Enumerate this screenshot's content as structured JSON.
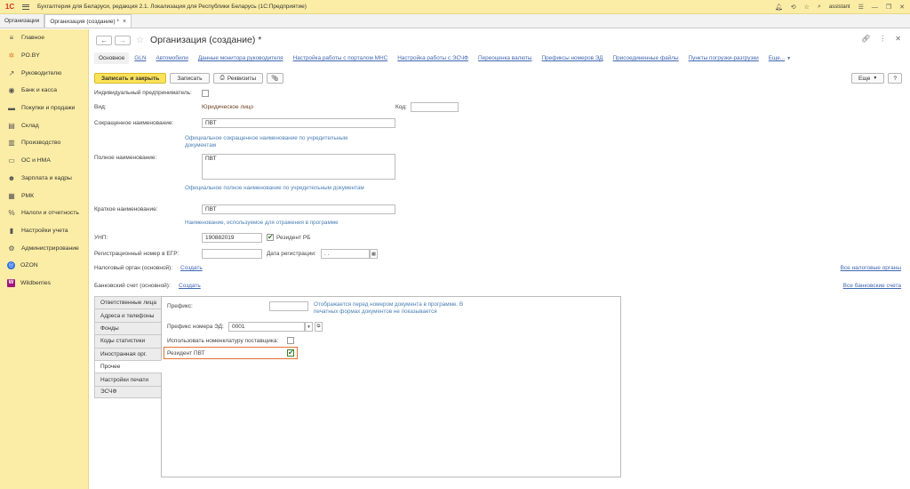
{
  "app": {
    "logo": "1С",
    "title": "Бухгалтерия для Беларуси, редакция 2.1. Локализация для Республики Беларусь  (1С:Предприятие)",
    "user": "assistant"
  },
  "tabs": [
    {
      "label": "Организации"
    },
    {
      "label": "Организация (создание) *",
      "close": "×"
    }
  ],
  "sidebar": {
    "items": [
      {
        "label": "Главное",
        "icon": "≡"
      },
      {
        "label": "PO.BY",
        "icon": "✲"
      },
      {
        "label": "Руководителю",
        "icon": "↗"
      },
      {
        "label": "Банк и касса",
        "icon": "◉"
      },
      {
        "label": "Покупки и продажи",
        "icon": "▬"
      },
      {
        "label": "Склад",
        "icon": "▤"
      },
      {
        "label": "Производство",
        "icon": "▥"
      },
      {
        "label": "ОС и НМА",
        "icon": "▭"
      },
      {
        "label": "Зарплата и кадры",
        "icon": "☻"
      },
      {
        "label": "РМК",
        "icon": "▦"
      },
      {
        "label": "Налоги и отчетность",
        "icon": "%"
      },
      {
        "label": "Настройки учета",
        "icon": "▮"
      },
      {
        "label": "Администрирование",
        "icon": "⚙"
      },
      {
        "label": "OZON",
        "icon": "◎"
      },
      {
        "label": "Wildberries",
        "icon": "W"
      }
    ]
  },
  "form": {
    "title": "Организация (создание) *",
    "links": [
      "Основное",
      "GLN",
      "Автомобили",
      "Данные монитора руководителя",
      "Настройка работы с порталом МНС",
      "Настройка работы с ЭСЧФ",
      "Переоценка валюты",
      "Префиксы номеров ЭД",
      "Присоединенные файлы",
      "Пункты погрузки-разгрузки",
      "Еще..."
    ],
    "buttons": {
      "save_close": "Записать и закрыть",
      "save": "Записать",
      "requisites": "Реквизиты",
      "more": "Еще",
      "help": "?"
    },
    "fields": {
      "ip_label": "Индивидуальный предприниматель:",
      "vid_label": "Вид:",
      "vid_value": "Юридическое лицо",
      "kod_label": "Код:",
      "short_name_label": "Сокращенное наименование:",
      "short_name_value": "ПВТ",
      "short_name_hint": "Официальное сокращенное наименование по учредительным документам",
      "full_name_label": "Полное наименование:",
      "full_name_value": "ПВТ",
      "full_name_hint": "Официальное полное наименование по учредительным документам",
      "brief_name_label": "Краткое наименование:",
      "brief_name_value": "ПВТ",
      "brief_name_hint": "Наименование, используемое для отражения в программе",
      "unp_label": "УНП:",
      "unp_value": "190882019",
      "resident_rb_label": "Резидент РБ",
      "egr_label": "Регистрационный номер в ЕГР:",
      "reg_date_label": "Дата регистрации:",
      "reg_date_value": " .  .",
      "tax_label": "Налоговый орган (основной):",
      "tax_link": "Создать",
      "tax_all": "Все налоговые органы",
      "bank_label": "Банковский счет (основной):",
      "bank_link": "Создать",
      "bank_all": "Все банковские счета"
    },
    "vtabs": [
      "Ответственные лица",
      "Адреса и телефоны",
      "Фонды",
      "Коды статистики",
      "Иностранная орг.",
      "Прочее",
      "Настройки печати",
      "ЭСЧФ"
    ],
    "panel": {
      "prefix_label": "Префикс:",
      "prefix_hint": "Отображается перед номером документа в программе. В печатных формах документов не показывается",
      "ed_prefix_label": "Префикс номера ЭД:",
      "ed_prefix_value": "0001",
      "nomenclature_label": "Использовать номенклатуру поставщика:",
      "pvt_label": "Резидент ПВТ"
    }
  }
}
